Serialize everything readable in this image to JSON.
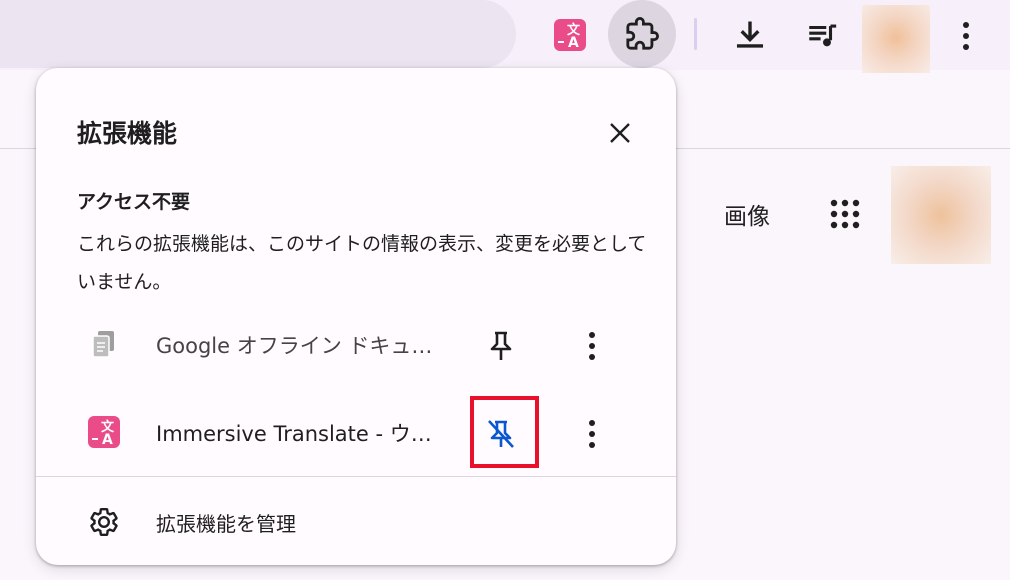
{
  "toolbar": {
    "translate_ext_icon": "immersive-translate-icon",
    "extensions_icon": "puzzle-piece-icon",
    "download_icon": "download-icon",
    "media_icon": "queue-music-icon",
    "more_icon": "vertical-dots-icon"
  },
  "page": {
    "images_link": "画像",
    "apps_icon": "apps-grid-icon"
  },
  "popup": {
    "title": "拡張機能",
    "close_icon": "close-icon",
    "section_heading": "アクセス不要",
    "section_description": "これらの拡張機能は、このサイトの情報の表示、変更を必要としていません。",
    "extensions": [
      {
        "name": "Google オフライン ドキュメント",
        "icon": "google-docs-offline-icon",
        "pin_state": "unpinned"
      },
      {
        "name": "Immersive Translate - ウェブサイト翻訳",
        "icon": "immersive-translate-icon",
        "pin_state": "pinned"
      }
    ],
    "manage_label": "拡張機能を管理",
    "manage_icon": "gear-icon"
  },
  "colors": {
    "accent_blue": "#0b57d0",
    "highlight_red": "#e8102a",
    "translate_pink": "#ea4c89"
  }
}
